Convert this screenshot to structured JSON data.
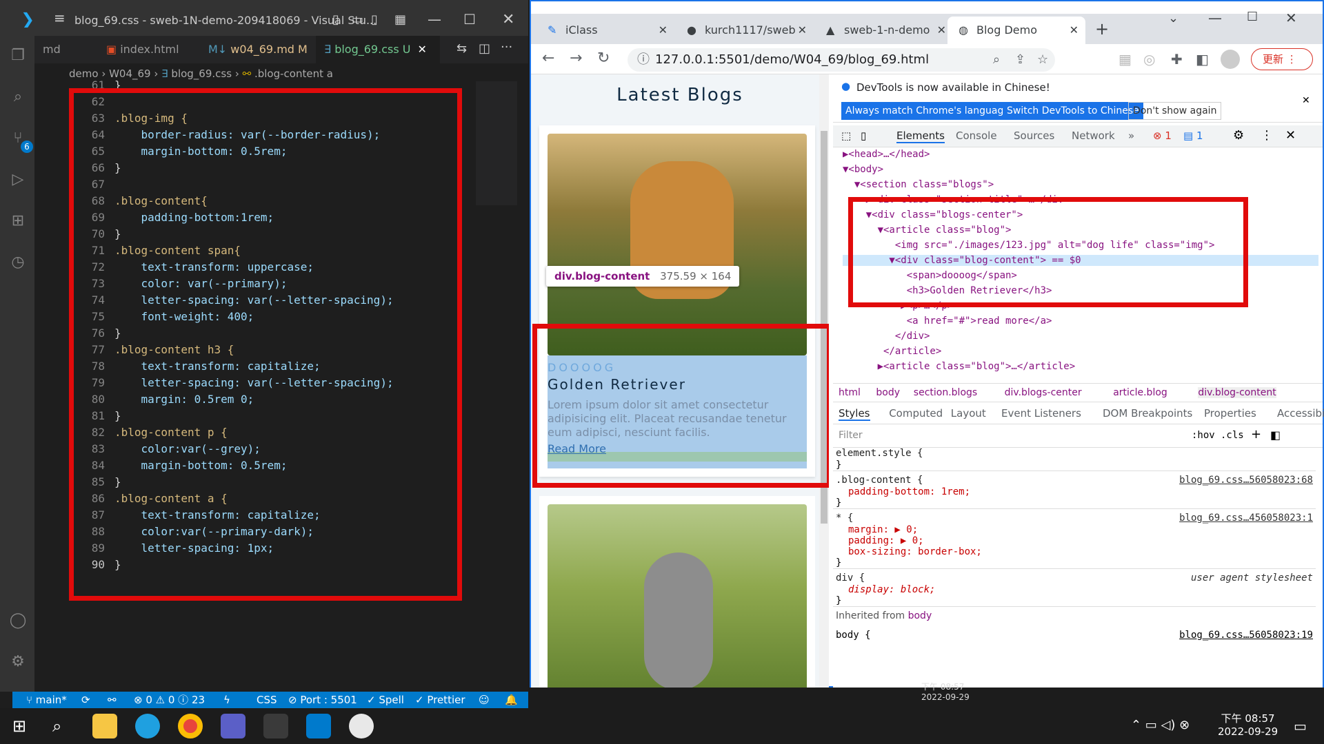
{
  "vscode": {
    "title": "blog_69.css - sweb-1N-demo-209418069 - Visual Stu...",
    "tabs": [
      {
        "label": "md"
      },
      {
        "label": "index.html"
      },
      {
        "label": "w04_69.md M"
      },
      {
        "label": "blog_69.css U"
      }
    ],
    "breadcrumb": [
      "demo",
      "W04_69",
      "blog_69.css",
      ".blog-content a"
    ],
    "source_control_badge": "6",
    "code_lines": [
      {
        "n": "61",
        "t": "}"
      },
      {
        "n": "62",
        "t": ""
      },
      {
        "n": "63",
        "t": ".blog-img {"
      },
      {
        "n": "64",
        "t": "    border-radius: var(--border-radius);"
      },
      {
        "n": "65",
        "t": "    margin-bottom: 0.5rem;"
      },
      {
        "n": "66",
        "t": "}"
      },
      {
        "n": "67",
        "t": ""
      },
      {
        "n": "68",
        "t": ".blog-content{"
      },
      {
        "n": "69",
        "t": "    padding-bottom:1rem;"
      },
      {
        "n": "70",
        "t": "}"
      },
      {
        "n": "71",
        "t": ".blog-content span{"
      },
      {
        "n": "72",
        "t": "    text-transform: uppercase;"
      },
      {
        "n": "73",
        "t": "    color: var(--primary);"
      },
      {
        "n": "74",
        "t": "    letter-spacing: var(--letter-spacing);"
      },
      {
        "n": "75",
        "t": "    font-weight: 400;"
      },
      {
        "n": "76",
        "t": "}"
      },
      {
        "n": "77",
        "t": ".blog-content h3 {"
      },
      {
        "n": "78",
        "t": "    text-transform: capitalize;"
      },
      {
        "n": "79",
        "t": "    letter-spacing: var(--letter-spacing);"
      },
      {
        "n": "80",
        "t": "    margin: 0.5rem 0;"
      },
      {
        "n": "81",
        "t": "}"
      },
      {
        "n": "82",
        "t": ".blog-content p {"
      },
      {
        "n": "83",
        "t": "    color:var(--grey);"
      },
      {
        "n": "84",
        "t": "    margin-bottom: 0.5rem;"
      },
      {
        "n": "85",
        "t": "}"
      },
      {
        "n": "86",
        "t": ".blog-content a {"
      },
      {
        "n": "87",
        "t": "    text-transform: capitalize;"
      },
      {
        "n": "88",
        "t": "    color:var(--primary-dark);"
      },
      {
        "n": "89",
        "t": "    letter-spacing: 1px;"
      },
      {
        "n": "90",
        "t": "}"
      }
    ],
    "status": {
      "branch": "main*",
      "problems": "⊗ 0 ⚠ 0 ⓘ 23",
      "language": "CSS",
      "port": "Port : 5501",
      "spell": "✓ Spell",
      "prettier": "✓ Prettier"
    }
  },
  "chrome": {
    "tabs": [
      {
        "label": "iClass"
      },
      {
        "label": "kurch1117/sweb"
      },
      {
        "label": "sweb-1-n-demo"
      },
      {
        "label": "Blog Demo"
      }
    ],
    "url": "127.0.0.1:5501/demo/W04_69/blog_69.html",
    "update_button": "更新",
    "page": {
      "title": "Latest Blogs",
      "tooltip_selector": "div.blog-content",
      "tooltip_size": "375.59 × 164",
      "blog_tag": "DOOOOG",
      "blog_title": "Golden Retriever",
      "blog_text": "Lorem ipsum dolor sit amet consectetur adipisicing elit. Placeat recusandae tenetur eum adipisci, nesciunt facilis.",
      "blog_link": "Read More"
    },
    "devtools": {
      "banner": "DevTools is now available in Chinese!",
      "btn_match": "Always match Chrome's language",
      "btn_switch": "Switch DevTools to Chinese",
      "btn_dont": "Don't show again",
      "panels": [
        "Elements",
        "Console",
        "Sources",
        "Network"
      ],
      "errors": "1",
      "messages": "1",
      "dom": [
        "▶<head>…</head>",
        "▼<body>",
        "  ▼<section class=\"blogs\">",
        "    ▶<div class=\"section-title\">…</div>",
        "    ▼<div class=\"blogs-center\">",
        "      ▼<article class=\"blog\">",
        "         <img src=\"./images/123.jpg\" alt=\"dog life\" class=\"img\">",
        "        ▼<div class=\"blog-content\"> == $0",
        "           <span>doooog</span>",
        "           <h3>Golden Retriever</h3>",
        "          ▶<p>…</p>",
        "           <a href=\"#\">read more</a>",
        "         </div>",
        "       </article>",
        "      ▶<article class=\"blog\">…</article>"
      ],
      "breadcrumbs": [
        "html",
        "body",
        "section.blogs",
        "div.blogs-center",
        "article.blog",
        "div.blog-content"
      ],
      "style_tabs": [
        "Styles",
        "Computed",
        "Layout",
        "Event Listeners",
        "DOM Breakpoints",
        "Properties",
        "Accessibility"
      ],
      "filter_placeholder": "Filter",
      "hov": ":hov",
      "cls": ".cls",
      "rules": [
        {
          "sel": "element.style {",
          "src": "",
          "props": []
        },
        {
          "sel": ".blog-content {",
          "src": "blog_69.css…56058023:68",
          "props": [
            "padding-bottom: 1rem;"
          ]
        },
        {
          "sel": "* {",
          "src": "blog_69.css…456058023:1",
          "props": [
            "margin: ▶ 0;",
            "padding: ▶ 0;",
            "box-sizing: border-box;"
          ]
        },
        {
          "sel": "div {",
          "src": "user agent stylesheet",
          "props": [
            "display: block;"
          ]
        }
      ],
      "inherited": "Inherited from",
      "inherited_el": "body",
      "body_rule": "body {",
      "body_src": "blog_69.css…56058023:19"
    }
  },
  "taskbar": {
    "time": "下午 08:57",
    "date": "2022-09-29",
    "time2": "下午 08:57",
    "date2": "2022-09-29"
  }
}
